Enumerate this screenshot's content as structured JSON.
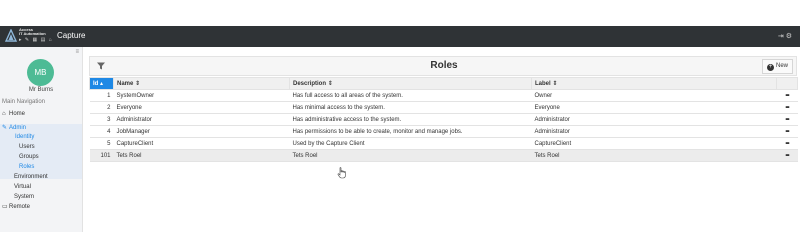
{
  "brand": {
    "line1": "Access",
    "line2": "IT Automation",
    "app_title": "Capture"
  },
  "header_icons": [
    "logout-icon",
    "settings-cogs-icon"
  ],
  "sidebar": {
    "collapse_icon": "collapse-icon",
    "avatar_initials": "MB",
    "user_name": "Mr Burns",
    "nav_heading": "Main Navigation",
    "items": {
      "home": "Home",
      "admin": "Admin",
      "identity": "Identity",
      "users": "Users",
      "groups": "Groups",
      "roles": "Roles",
      "environment": "Environment",
      "virtual": "Virtual",
      "system": "System",
      "remote": "Remote"
    },
    "accent_color": "#1e88e5"
  },
  "panel": {
    "title": "Roles",
    "new_button": "New",
    "columns": {
      "id": "Id",
      "name": "Name",
      "description": "Description",
      "label": "Label"
    },
    "sorted_column": "id",
    "sort_direction": "ascending",
    "rows": [
      {
        "id": "1",
        "name": "SystemOwner",
        "description": "Has full access to all areas of the system.",
        "label": "Owner",
        "menu": "•••"
      },
      {
        "id": "2",
        "name": "Everyone",
        "description": "Has minimal access to the system.",
        "label": "Everyone",
        "menu": "•••"
      },
      {
        "id": "3",
        "name": "Administrator",
        "description": "Has administrative access to the system.",
        "label": "Administrator",
        "menu": "•••"
      },
      {
        "id": "4",
        "name": "JobManager",
        "description": "Has permissions to be able to create, monitor and manage jobs.",
        "label": "Administrator",
        "menu": "•••"
      },
      {
        "id": "5",
        "name": "CaptureClient",
        "description": "Used by the Capture Client",
        "label": "CaptureClient",
        "menu": "•••"
      },
      {
        "id": "101",
        "name": "Tets Roel",
        "description": "Tets Roel",
        "label": "Tets Roel",
        "menu": "•••"
      }
    ]
  }
}
